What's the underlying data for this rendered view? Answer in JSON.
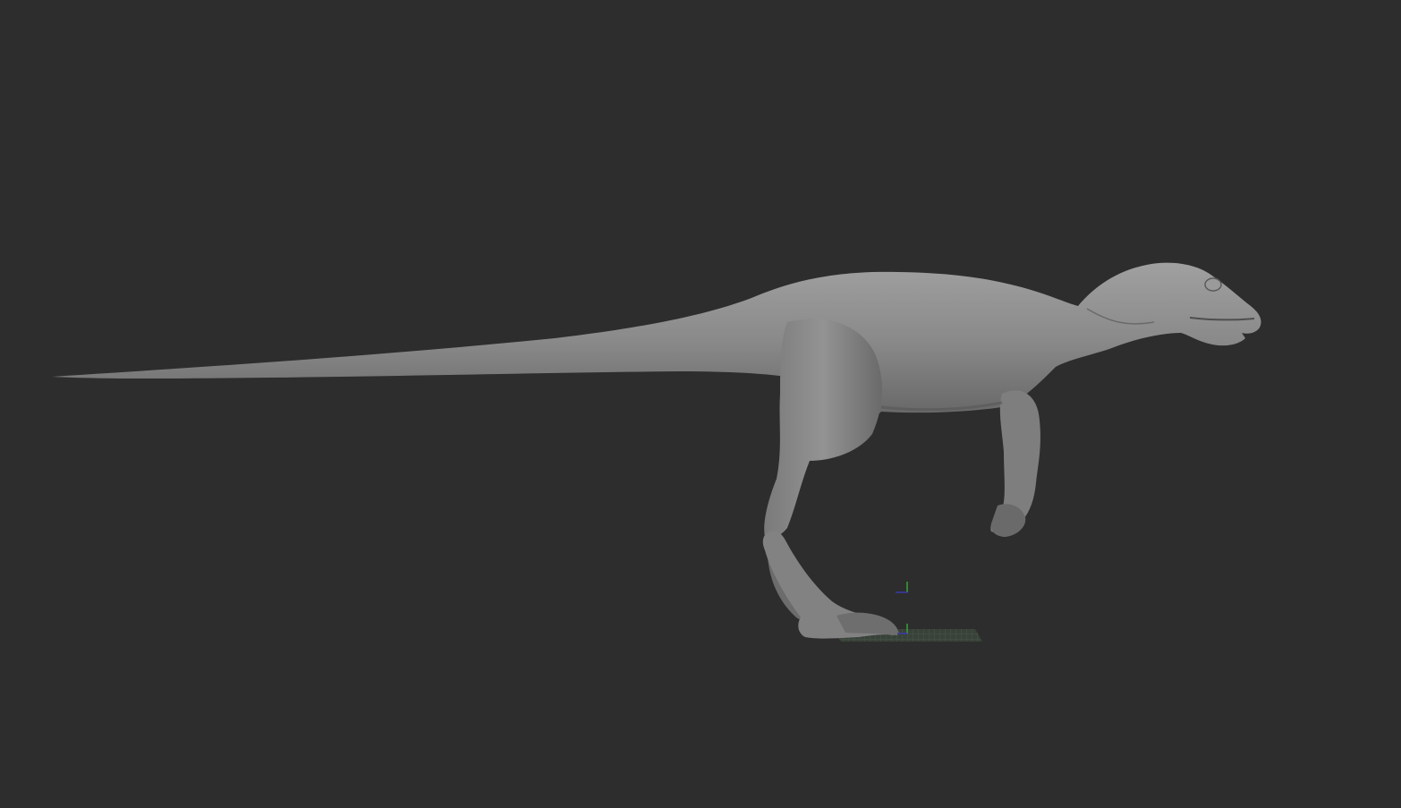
{
  "viewport": {
    "background_color": "#2d2d2d",
    "model": {
      "subject": "dinosaur-sculpt",
      "material_color": "#8a8a8a",
      "shadow_color": "#5e5e5e",
      "highlight_color": "#a4a4a4"
    },
    "floor_grid": {
      "color": "#4a5a4a"
    },
    "gizmo": {
      "x_axis_color": "#3a3aa8",
      "y_axis_color": "#2fa82f",
      "icon": "transpose-gizmo-icon"
    }
  }
}
